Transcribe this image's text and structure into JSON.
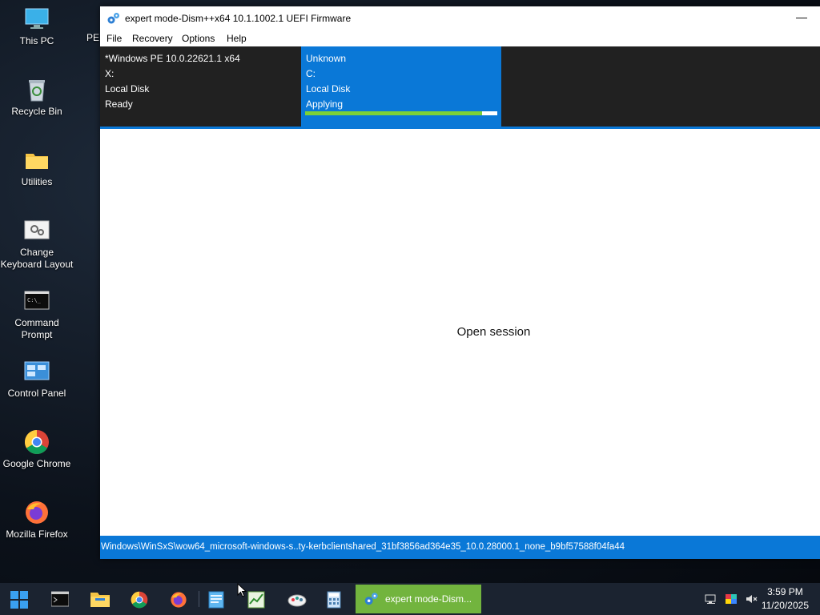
{
  "desktop": {
    "icons": [
      {
        "label": "This PC",
        "icon": "monitor-icon"
      },
      {
        "label": "Recycle Bin",
        "icon": "recycle-bin-icon"
      },
      {
        "label": "Utilities",
        "icon": "folder-icon"
      },
      {
        "label": "Change Keyboard Layout",
        "icon": "keyboard-settings-icon"
      },
      {
        "label": "Command Prompt",
        "icon": "command-prompt-icon"
      },
      {
        "label": "Control Panel",
        "icon": "control-panel-icon"
      },
      {
        "label": "Google Chrome",
        "icon": "chrome-icon"
      },
      {
        "label": "Mozilla Firefox",
        "icon": "firefox-icon"
      }
    ],
    "partial_label": "PE"
  },
  "window": {
    "title": "expert mode-Dism++x64 10.1.1002.1 UEFI Firmware",
    "minimize_glyph": "—",
    "menu": [
      "File",
      "Recovery",
      "Options",
      "Help"
    ],
    "sessions": [
      {
        "name": "*Windows PE 10.0.22621.1 x64",
        "drive": "X:",
        "disk": "Local Disk",
        "status": "Ready"
      },
      {
        "name": "Unknown",
        "drive": "C:",
        "disk": "Local Disk",
        "status": "Applying",
        "progress_percent": 92
      }
    ],
    "content_message": "Open session",
    "status_path": "Windows\\WinSxS\\wow64_microsoft-windows-s..ty-kerbclientshared_31bf3856ad364e35_10.0.28000.1_none_b9bf57588f04fa44"
  },
  "taskbar": {
    "pinned": [
      "start-icon",
      "command-prompt-icon",
      "file-explorer-icon",
      "chrome-icon",
      "firefox-icon",
      "notepad-icon",
      "task-manager-icon",
      "paint-icon",
      "calculator-icon"
    ],
    "active_task_label": "expert mode-Dism...",
    "clock_time": "3:59 PM",
    "clock_date": "11/20/2025"
  },
  "colors": {
    "accent_blue": "#0a78d7",
    "progress_green": "#7cd137",
    "task_green": "#72b43e",
    "session_bg": "#212121"
  }
}
